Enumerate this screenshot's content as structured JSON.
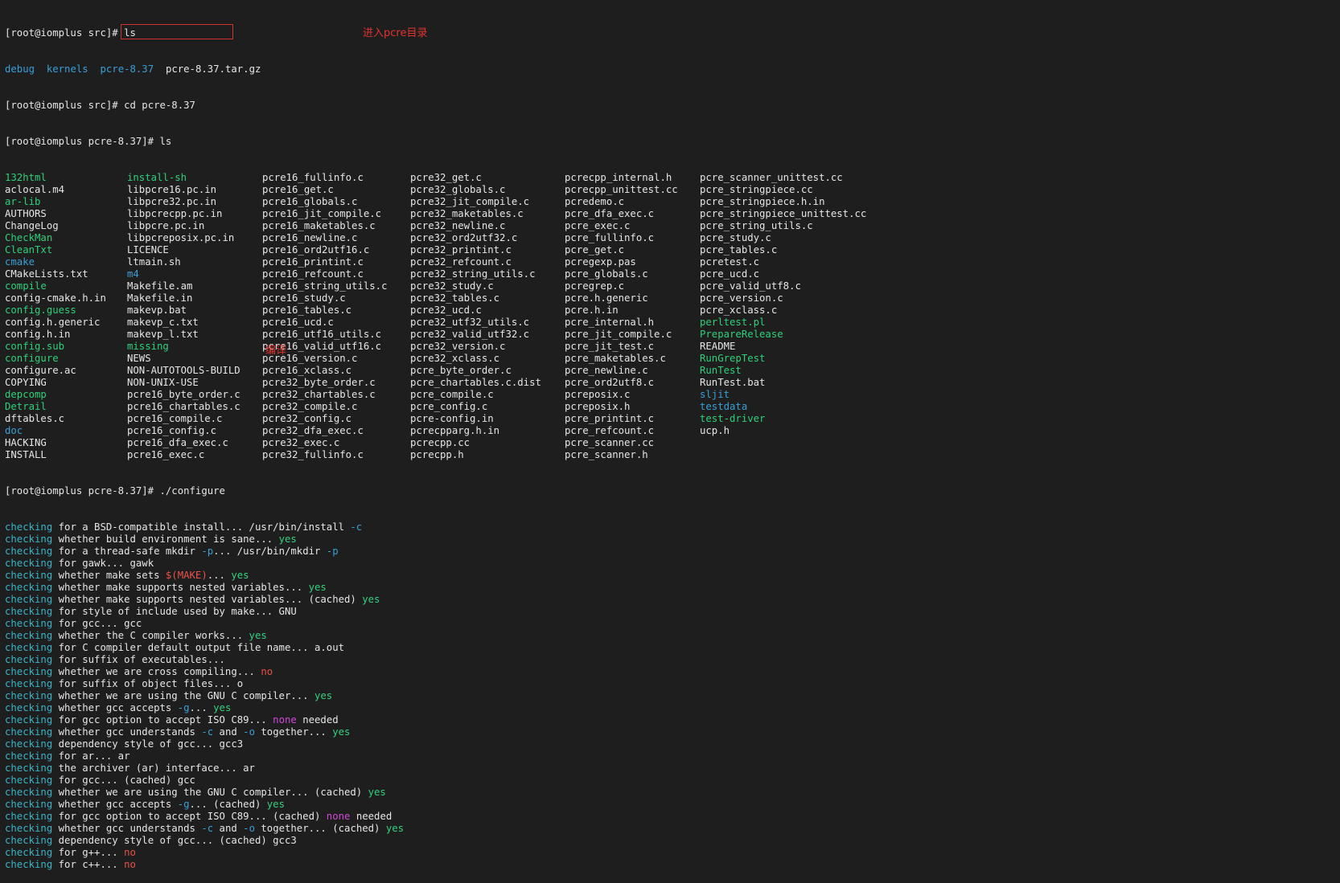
{
  "colors": {
    "background": "#1e1e1e",
    "text": "#e6e6e6",
    "directory": "#3a9fd6",
    "executable": "#2fd07a",
    "checking": "#3ab4c8",
    "yes": "#36d07f",
    "no": "#e8504a",
    "none": "#d048d8",
    "annotation": "#e0332f"
  },
  "session": {
    "line1_prompt": "[root@iomplus src]# ",
    "line1_cmd": "ls",
    "src_listing": [
      {
        "name": "debug",
        "kind": "dir"
      },
      {
        "name": "kernels",
        "kind": "dir"
      },
      {
        "name": "pcre-8.37",
        "kind": "dir"
      },
      {
        "name": "pcre-8.37.tar.gz",
        "kind": "file"
      }
    ],
    "line3_prompt": "[root@iomplus src]# ",
    "line3_cmd": "cd pcre-8.37",
    "line4_prompt": "[root@iomplus pcre-8.37]# ",
    "line4_cmd": "ls",
    "configure_prompt": "[root@iomplus pcre-8.37]# ",
    "configure_cmd": "./configure"
  },
  "annotations": {
    "cd_note": "进入pcre目录",
    "build_note": "编译"
  },
  "ls_columns": [
    [
      {
        "name": "132html",
        "kind": "exec"
      },
      {
        "name": "aclocal.m4",
        "kind": "file"
      },
      {
        "name": "ar-lib",
        "kind": "exec"
      },
      {
        "name": "AUTHORS",
        "kind": "file"
      },
      {
        "name": "ChangeLog",
        "kind": "file"
      },
      {
        "name": "CheckMan",
        "kind": "exec"
      },
      {
        "name": "CleanTxt",
        "kind": "exec"
      },
      {
        "name": "cmake",
        "kind": "dir"
      },
      {
        "name": "CMakeLists.txt",
        "kind": "file"
      },
      {
        "name": "compile",
        "kind": "exec"
      },
      {
        "name": "config-cmake.h.in",
        "kind": "file"
      },
      {
        "name": "config.guess",
        "kind": "exec"
      },
      {
        "name": "config.h.generic",
        "kind": "file"
      },
      {
        "name": "config.h.in",
        "kind": "file"
      },
      {
        "name": "config.sub",
        "kind": "exec"
      },
      {
        "name": "configure",
        "kind": "exec"
      },
      {
        "name": "configure.ac",
        "kind": "file"
      },
      {
        "name": "COPYING",
        "kind": "file"
      },
      {
        "name": "depcomp",
        "kind": "exec"
      },
      {
        "name": "Detrail",
        "kind": "exec"
      },
      {
        "name": "dftables.c",
        "kind": "file"
      },
      {
        "name": "doc",
        "kind": "dir"
      },
      {
        "name": "HACKING",
        "kind": "file"
      },
      {
        "name": "INSTALL",
        "kind": "file"
      }
    ],
    [
      {
        "name": "install-sh",
        "kind": "exec"
      },
      {
        "name": "libpcre16.pc.in",
        "kind": "file"
      },
      {
        "name": "libpcre32.pc.in",
        "kind": "file"
      },
      {
        "name": "libpcrecpp.pc.in",
        "kind": "file"
      },
      {
        "name": "libpcre.pc.in",
        "kind": "file"
      },
      {
        "name": "libpcreposix.pc.in",
        "kind": "file"
      },
      {
        "name": "LICENCE",
        "kind": "file"
      },
      {
        "name": "ltmain.sh",
        "kind": "file"
      },
      {
        "name": "m4",
        "kind": "dir"
      },
      {
        "name": "Makefile.am",
        "kind": "file"
      },
      {
        "name": "Makefile.in",
        "kind": "file"
      },
      {
        "name": "makevp.bat",
        "kind": "file"
      },
      {
        "name": "makevp_c.txt",
        "kind": "file"
      },
      {
        "name": "makevp_l.txt",
        "kind": "file"
      },
      {
        "name": "missing",
        "kind": "exec"
      },
      {
        "name": "NEWS",
        "kind": "file"
      },
      {
        "name": "NON-AUTOTOOLS-BUILD",
        "kind": "file"
      },
      {
        "name": "NON-UNIX-USE",
        "kind": "file"
      },
      {
        "name": "pcre16_byte_order.c",
        "kind": "file"
      },
      {
        "name": "pcre16_chartables.c",
        "kind": "file"
      },
      {
        "name": "pcre16_compile.c",
        "kind": "file"
      },
      {
        "name": "pcre16_config.c",
        "kind": "file"
      },
      {
        "name": "pcre16_dfa_exec.c",
        "kind": "file"
      },
      {
        "name": "pcre16_exec.c",
        "kind": "file"
      }
    ],
    [
      {
        "name": "pcre16_fullinfo.c",
        "kind": "file"
      },
      {
        "name": "pcre16_get.c",
        "kind": "file"
      },
      {
        "name": "pcre16_globals.c",
        "kind": "file"
      },
      {
        "name": "pcre16_jit_compile.c",
        "kind": "file"
      },
      {
        "name": "pcre16_maketables.c",
        "kind": "file"
      },
      {
        "name": "pcre16_newline.c",
        "kind": "file"
      },
      {
        "name": "pcre16_ord2utf16.c",
        "kind": "file"
      },
      {
        "name": "pcre16_printint.c",
        "kind": "file"
      },
      {
        "name": "pcre16_refcount.c",
        "kind": "file"
      },
      {
        "name": "pcre16_string_utils.c",
        "kind": "file"
      },
      {
        "name": "pcre16_study.c",
        "kind": "file"
      },
      {
        "name": "pcre16_tables.c",
        "kind": "file"
      },
      {
        "name": "pcre16_ucd.c",
        "kind": "file"
      },
      {
        "name": "pcre16_utf16_utils.c",
        "kind": "file"
      },
      {
        "name": "pcre16_valid_utf16.c",
        "kind": "file"
      },
      {
        "name": "pcre16_version.c",
        "kind": "file"
      },
      {
        "name": "pcre16_xclass.c",
        "kind": "file"
      },
      {
        "name": "pcre32_byte_order.c",
        "kind": "file"
      },
      {
        "name": "pcre32_chartables.c",
        "kind": "file"
      },
      {
        "name": "pcre32_compile.c",
        "kind": "file"
      },
      {
        "name": "pcre32_config.c",
        "kind": "file"
      },
      {
        "name": "pcre32_dfa_exec.c",
        "kind": "file"
      },
      {
        "name": "pcre32_exec.c",
        "kind": "file"
      },
      {
        "name": "pcre32_fullinfo.c",
        "kind": "file"
      }
    ],
    [
      {
        "name": "pcre32_get.c",
        "kind": "file"
      },
      {
        "name": "pcre32_globals.c",
        "kind": "file"
      },
      {
        "name": "pcre32_jit_compile.c",
        "kind": "file"
      },
      {
        "name": "pcre32_maketables.c",
        "kind": "file"
      },
      {
        "name": "pcre32_newline.c",
        "kind": "file"
      },
      {
        "name": "pcre32_ord2utf32.c",
        "kind": "file"
      },
      {
        "name": "pcre32_printint.c",
        "kind": "file"
      },
      {
        "name": "pcre32_refcount.c",
        "kind": "file"
      },
      {
        "name": "pcre32_string_utils.c",
        "kind": "file"
      },
      {
        "name": "pcre32_study.c",
        "kind": "file"
      },
      {
        "name": "pcre32_tables.c",
        "kind": "file"
      },
      {
        "name": "pcre32_ucd.c",
        "kind": "file"
      },
      {
        "name": "pcre32_utf32_utils.c",
        "kind": "file"
      },
      {
        "name": "pcre32_valid_utf32.c",
        "kind": "file"
      },
      {
        "name": "pcre32_version.c",
        "kind": "file"
      },
      {
        "name": "pcre32_xclass.c",
        "kind": "file"
      },
      {
        "name": "pcre_byte_order.c",
        "kind": "file"
      },
      {
        "name": "pcre_chartables.c.dist",
        "kind": "file"
      },
      {
        "name": "pcre_compile.c",
        "kind": "file"
      },
      {
        "name": "pcre_config.c",
        "kind": "file"
      },
      {
        "name": "pcre-config.in",
        "kind": "file"
      },
      {
        "name": "pcrecpparg.h.in",
        "kind": "file"
      },
      {
        "name": "pcrecpp.cc",
        "kind": "file"
      },
      {
        "name": "pcrecpp.h",
        "kind": "file"
      }
    ],
    [
      {
        "name": "pcrecpp_internal.h",
        "kind": "file"
      },
      {
        "name": "pcrecpp_unittest.cc",
        "kind": "file"
      },
      {
        "name": "pcredemo.c",
        "kind": "file"
      },
      {
        "name": "pcre_dfa_exec.c",
        "kind": "file"
      },
      {
        "name": "pcre_exec.c",
        "kind": "file"
      },
      {
        "name": "pcre_fullinfo.c",
        "kind": "file"
      },
      {
        "name": "pcre_get.c",
        "kind": "file"
      },
      {
        "name": "pcregexp.pas",
        "kind": "file"
      },
      {
        "name": "pcre_globals.c",
        "kind": "file"
      },
      {
        "name": "pcregrep.c",
        "kind": "file"
      },
      {
        "name": "pcre.h.generic",
        "kind": "file"
      },
      {
        "name": "pcre.h.in",
        "kind": "file"
      },
      {
        "name": "pcre_internal.h",
        "kind": "file"
      },
      {
        "name": "pcre_jit_compile.c",
        "kind": "file"
      },
      {
        "name": "pcre_jit_test.c",
        "kind": "file"
      },
      {
        "name": "pcre_maketables.c",
        "kind": "file"
      },
      {
        "name": "pcre_newline.c",
        "kind": "file"
      },
      {
        "name": "pcre_ord2utf8.c",
        "kind": "file"
      },
      {
        "name": "pcreposix.c",
        "kind": "file"
      },
      {
        "name": "pcreposix.h",
        "kind": "file"
      },
      {
        "name": "pcre_printint.c",
        "kind": "file"
      },
      {
        "name": "pcre_refcount.c",
        "kind": "file"
      },
      {
        "name": "pcre_scanner.cc",
        "kind": "file"
      },
      {
        "name": "pcre_scanner.h",
        "kind": "file"
      }
    ],
    [
      {
        "name": "pcre_scanner_unittest.cc",
        "kind": "file"
      },
      {
        "name": "pcre_stringpiece.cc",
        "kind": "file"
      },
      {
        "name": "pcre_stringpiece.h.in",
        "kind": "file"
      },
      {
        "name": "pcre_stringpiece_unittest.cc",
        "kind": "file"
      },
      {
        "name": "pcre_string_utils.c",
        "kind": "file"
      },
      {
        "name": "pcre_study.c",
        "kind": "file"
      },
      {
        "name": "pcre_tables.c",
        "kind": "file"
      },
      {
        "name": "pcretest.c",
        "kind": "file"
      },
      {
        "name": "pcre_ucd.c",
        "kind": "file"
      },
      {
        "name": "pcre_valid_utf8.c",
        "kind": "file"
      },
      {
        "name": "pcre_version.c",
        "kind": "file"
      },
      {
        "name": "pcre_xclass.c",
        "kind": "file"
      },
      {
        "name": "perltest.pl",
        "kind": "exec"
      },
      {
        "name": "PrepareRelease",
        "kind": "exec"
      },
      {
        "name": "README",
        "kind": "file"
      },
      {
        "name": "RunGrepTest",
        "kind": "exec"
      },
      {
        "name": "RunTest",
        "kind": "exec"
      },
      {
        "name": "RunTest.bat",
        "kind": "file"
      },
      {
        "name": "sljit",
        "kind": "dir"
      },
      {
        "name": "testdata",
        "kind": "dir"
      },
      {
        "name": "test-driver",
        "kind": "exec"
      },
      {
        "name": "ucp.h",
        "kind": "file"
      }
    ]
  ],
  "configure_output": [
    [
      [
        "checking",
        "cyan"
      ],
      [
        " for a BSD-compatible install... /usr/bin/install ",
        "white"
      ],
      [
        "-c",
        "dir"
      ]
    ],
    [
      [
        "checking",
        "cyan"
      ],
      [
        " whether build environment is sane... ",
        "white"
      ],
      [
        "yes",
        "green"
      ]
    ],
    [
      [
        "checking",
        "cyan"
      ],
      [
        " for a thread-safe mkdir ",
        "white"
      ],
      [
        "-p",
        "dir"
      ],
      [
        "... /usr/bin/mkdir ",
        "white"
      ],
      [
        "-p",
        "dir"
      ]
    ],
    [
      [
        "checking",
        "cyan"
      ],
      [
        " for gawk... gawk",
        "white"
      ]
    ],
    [
      [
        "checking",
        "cyan"
      ],
      [
        " whether make sets ",
        "white"
      ],
      [
        "$(MAKE)",
        "red"
      ],
      [
        "... ",
        "white"
      ],
      [
        "yes",
        "green"
      ]
    ],
    [
      [
        "checking",
        "cyan"
      ],
      [
        " whether make supports nested variables... ",
        "white"
      ],
      [
        "yes",
        "green"
      ]
    ],
    [
      [
        "checking",
        "cyan"
      ],
      [
        " whether make supports nested variables... (cached) ",
        "white"
      ],
      [
        "yes",
        "green"
      ]
    ],
    [
      [
        "checking",
        "cyan"
      ],
      [
        " for style of include used by make... GNU",
        "white"
      ]
    ],
    [
      [
        "checking",
        "cyan"
      ],
      [
        " for gcc... gcc",
        "white"
      ]
    ],
    [
      [
        "checking",
        "cyan"
      ],
      [
        " whether the C compiler works... ",
        "white"
      ],
      [
        "yes",
        "green"
      ]
    ],
    [
      [
        "checking",
        "cyan"
      ],
      [
        " for C compiler default output file name... a.out",
        "white"
      ]
    ],
    [
      [
        "checking",
        "cyan"
      ],
      [
        " for suffix of executables... ",
        "white"
      ]
    ],
    [
      [
        "checking",
        "cyan"
      ],
      [
        " whether we are cross compiling... ",
        "white"
      ],
      [
        "no",
        "red"
      ]
    ],
    [
      [
        "checking",
        "cyan"
      ],
      [
        " for suffix of object files... o",
        "white"
      ]
    ],
    [
      [
        "checking",
        "cyan"
      ],
      [
        " whether we are using the GNU C compiler... ",
        "white"
      ],
      [
        "yes",
        "green"
      ]
    ],
    [
      [
        "checking",
        "cyan"
      ],
      [
        " whether gcc accepts ",
        "white"
      ],
      [
        "-g",
        "dir"
      ],
      [
        "... ",
        "white"
      ],
      [
        "yes",
        "green"
      ]
    ],
    [
      [
        "checking",
        "cyan"
      ],
      [
        " for gcc option to accept ISO C89... ",
        "white"
      ],
      [
        "none",
        "magenta"
      ],
      [
        " needed",
        "white"
      ]
    ],
    [
      [
        "checking",
        "cyan"
      ],
      [
        " whether gcc understands ",
        "white"
      ],
      [
        "-c",
        "dir"
      ],
      [
        " and ",
        "white"
      ],
      [
        "-o",
        "dir"
      ],
      [
        " together... ",
        "white"
      ],
      [
        "yes",
        "green"
      ]
    ],
    [
      [
        "checking",
        "cyan"
      ],
      [
        " dependency style of gcc... gcc3",
        "white"
      ]
    ],
    [
      [
        "checking",
        "cyan"
      ],
      [
        " for ar... ar",
        "white"
      ]
    ],
    [
      [
        "checking",
        "cyan"
      ],
      [
        " the archiver (ar) interface... ar",
        "white"
      ]
    ],
    [
      [
        "checking",
        "cyan"
      ],
      [
        " for gcc... (cached) gcc",
        "white"
      ]
    ],
    [
      [
        "checking",
        "cyan"
      ],
      [
        " whether we are using the GNU C compiler... (cached) ",
        "white"
      ],
      [
        "yes",
        "green"
      ]
    ],
    [
      [
        "checking",
        "cyan"
      ],
      [
        " whether gcc accepts ",
        "white"
      ],
      [
        "-g",
        "dir"
      ],
      [
        "... (cached) ",
        "white"
      ],
      [
        "yes",
        "green"
      ]
    ],
    [
      [
        "checking",
        "cyan"
      ],
      [
        " for gcc option to accept ISO C89... (cached) ",
        "white"
      ],
      [
        "none",
        "magenta"
      ],
      [
        " needed",
        "white"
      ]
    ],
    [
      [
        "checking",
        "cyan"
      ],
      [
        " whether gcc understands ",
        "white"
      ],
      [
        "-c",
        "dir"
      ],
      [
        " and ",
        "white"
      ],
      [
        "-o",
        "dir"
      ],
      [
        " together... (cached) ",
        "white"
      ],
      [
        "yes",
        "green"
      ]
    ],
    [
      [
        "checking",
        "cyan"
      ],
      [
        " dependency style of gcc... (cached) gcc3",
        "white"
      ]
    ],
    [
      [
        "checking",
        "cyan"
      ],
      [
        " for g++... ",
        "white"
      ],
      [
        "no",
        "red"
      ]
    ],
    [
      [
        "checking",
        "cyan"
      ],
      [
        " for c++... ",
        "white"
      ],
      [
        "no",
        "red"
      ]
    ]
  ]
}
